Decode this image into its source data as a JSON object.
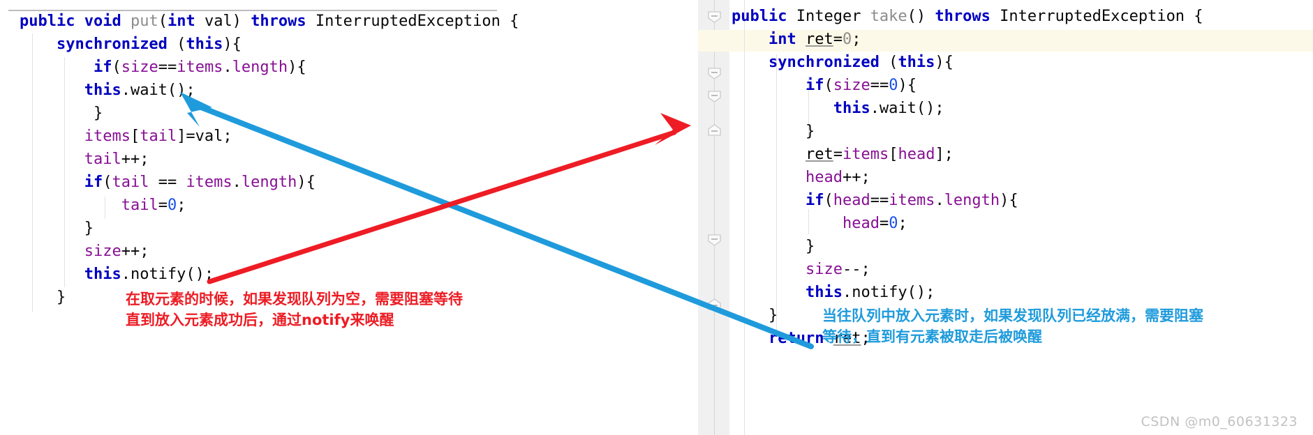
{
  "editor": {
    "left_pane": {
      "name": "put-method-editor",
      "lines": [
        [
          {
            "t": "public ",
            "c": "kw"
          },
          {
            "t": "void ",
            "c": "kw"
          },
          {
            "t": "put",
            "c": "meth"
          },
          {
            "t": "(",
            "c": "pln"
          },
          {
            "t": "int",
            "c": "kw"
          },
          {
            "t": " val) ",
            "c": "pln"
          },
          {
            "t": "throws",
            "c": "kw"
          },
          {
            "t": " InterruptedException {",
            "c": "pln"
          }
        ],
        [
          {
            "t": "    ",
            "c": "pln"
          },
          {
            "t": "synchronized",
            "c": "kw"
          },
          {
            "t": " (",
            "c": "pln"
          },
          {
            "t": "this",
            "c": "kw"
          },
          {
            "t": "){",
            "c": "pln"
          }
        ],
        [
          {
            "t": "        ",
            "c": "pln"
          },
          {
            "t": "if",
            "c": "kw"
          },
          {
            "t": "(",
            "c": "pln"
          },
          {
            "t": "size",
            "c": "fld"
          },
          {
            "t": "==",
            "c": "pln"
          },
          {
            "t": "items",
            "c": "fld"
          },
          {
            "t": ".",
            "c": "pln"
          },
          {
            "t": "length",
            "c": "fld"
          },
          {
            "t": "){",
            "c": "pln"
          }
        ],
        [
          {
            "t": "       ",
            "c": "pln"
          },
          {
            "t": "this",
            "c": "kw"
          },
          {
            "t": ".wait();",
            "c": "pln"
          }
        ],
        [
          {
            "t": "        }",
            "c": "pln"
          }
        ],
        [
          {
            "t": "       ",
            "c": "pln"
          },
          {
            "t": "items",
            "c": "fld"
          },
          {
            "t": "[",
            "c": "pln"
          },
          {
            "t": "tail",
            "c": "fld"
          },
          {
            "t": "]=val;",
            "c": "pln"
          }
        ],
        [
          {
            "t": "       ",
            "c": "pln"
          },
          {
            "t": "tail",
            "c": "fld"
          },
          {
            "t": "++;",
            "c": "pln"
          }
        ],
        [
          {
            "t": "       ",
            "c": "pln"
          },
          {
            "t": "if",
            "c": "kw"
          },
          {
            "t": "(",
            "c": "pln"
          },
          {
            "t": "tail",
            "c": "fld"
          },
          {
            "t": " == ",
            "c": "pln"
          },
          {
            "t": "items",
            "c": "fld"
          },
          {
            "t": ".",
            "c": "pln"
          },
          {
            "t": "length",
            "c": "fld"
          },
          {
            "t": "){",
            "c": "pln"
          }
        ],
        [
          {
            "t": "           ",
            "c": "pln"
          },
          {
            "t": "tail",
            "c": "fld"
          },
          {
            "t": "=",
            "c": "pln"
          },
          {
            "t": "0",
            "c": "num"
          },
          {
            "t": ";",
            "c": "pln"
          }
        ],
        [
          {
            "t": "       }",
            "c": "pln"
          }
        ],
        [
          {
            "t": "       ",
            "c": "pln"
          },
          {
            "t": "size",
            "c": "fld"
          },
          {
            "t": "++;",
            "c": "pln"
          }
        ],
        [
          {
            "t": "       ",
            "c": "pln"
          },
          {
            "t": "this",
            "c": "kw"
          },
          {
            "t": ".notify();",
            "c": "pln"
          }
        ],
        [
          {
            "t": "    }",
            "c": "pln"
          }
        ]
      ]
    },
    "right_pane": {
      "name": "take-method-editor",
      "lines": [
        [
          {
            "t": "public ",
            "c": "kw"
          },
          {
            "t": "Integer ",
            "c": "pln"
          },
          {
            "t": "take",
            "c": "meth"
          },
          {
            "t": "() ",
            "c": "pln"
          },
          {
            "t": "throws",
            "c": "kw"
          },
          {
            "t": " InterruptedException {",
            "c": "pln"
          }
        ],
        [
          {
            "t": "    ",
            "c": "pln"
          },
          {
            "t": "int",
            "c": "kw"
          },
          {
            "t": " ",
            "c": "pln"
          },
          {
            "t": "ret",
            "c": "under"
          },
          {
            "t": "=",
            "c": "pln"
          },
          {
            "t": "0",
            "c": "meth"
          },
          {
            "t": ";",
            "c": "pln"
          }
        ],
        [
          {
            "t": "    ",
            "c": "pln"
          },
          {
            "t": "synchronized",
            "c": "kw"
          },
          {
            "t": " (",
            "c": "pln"
          },
          {
            "t": "this",
            "c": "kw"
          },
          {
            "t": "){",
            "c": "pln"
          }
        ],
        [
          {
            "t": "        ",
            "c": "pln"
          },
          {
            "t": "if",
            "c": "kw"
          },
          {
            "t": "(",
            "c": "pln"
          },
          {
            "t": "size",
            "c": "fld"
          },
          {
            "t": "==",
            "c": "pln"
          },
          {
            "t": "0",
            "c": "num"
          },
          {
            "t": "){",
            "c": "pln"
          }
        ],
        [
          {
            "t": "           ",
            "c": "pln"
          },
          {
            "t": "this",
            "c": "kw"
          },
          {
            "t": ".wait();",
            "c": "pln"
          }
        ],
        [
          {
            "t": "        }",
            "c": "pln"
          }
        ],
        [
          {
            "t": "        ",
            "c": "pln"
          },
          {
            "t": "ret",
            "c": "under"
          },
          {
            "t": "=",
            "c": "pln"
          },
          {
            "t": "items",
            "c": "fld"
          },
          {
            "t": "[",
            "c": "pln"
          },
          {
            "t": "head",
            "c": "fld"
          },
          {
            "t": "];",
            "c": "pln"
          }
        ],
        [
          {
            "t": "        ",
            "c": "pln"
          },
          {
            "t": "head",
            "c": "fld"
          },
          {
            "t": "++;",
            "c": "pln"
          }
        ],
        [
          {
            "t": "        ",
            "c": "pln"
          },
          {
            "t": "if",
            "c": "kw"
          },
          {
            "t": "(",
            "c": "pln"
          },
          {
            "t": "head",
            "c": "fld"
          },
          {
            "t": "==",
            "c": "pln"
          },
          {
            "t": "items",
            "c": "fld"
          },
          {
            "t": ".",
            "c": "pln"
          },
          {
            "t": "length",
            "c": "fld"
          },
          {
            "t": "){",
            "c": "pln"
          }
        ],
        [
          {
            "t": "            ",
            "c": "pln"
          },
          {
            "t": "head",
            "c": "fld"
          },
          {
            "t": "=",
            "c": "pln"
          },
          {
            "t": "0",
            "c": "num"
          },
          {
            "t": ";",
            "c": "pln"
          }
        ],
        [
          {
            "t": "        }",
            "c": "pln"
          }
        ],
        [
          {
            "t": "        ",
            "c": "pln"
          },
          {
            "t": "size",
            "c": "fld"
          },
          {
            "t": "--;",
            "c": "pln"
          }
        ],
        [
          {
            "t": "        ",
            "c": "pln"
          },
          {
            "t": "this",
            "c": "kw"
          },
          {
            "t": ".notify();",
            "c": "pln"
          }
        ],
        [
          {
            "t": "    }",
            "c": "pln"
          }
        ],
        [
          {
            "t": "    ",
            "c": "pln"
          },
          {
            "t": "return",
            "c": "kw"
          },
          {
            "t": " ",
            "c": "pln"
          },
          {
            "t": "ret",
            "c": "under"
          },
          {
            "t": ";",
            "c": "pln"
          }
        ]
      ]
    }
  },
  "annotations": {
    "red": {
      "name": "red-annotation",
      "text": "在取元素的时候，如果发现队列为空，需要阻塞等待\n直到放入元素成功后，通过notify来唤醒",
      "color": "#ec1c24",
      "arrow_from": "this.notify() in put()",
      "arrow_to": "this.wait() in take()"
    },
    "blue": {
      "name": "blue-annotation",
      "text": "当往队列中放入元素时，如果发现队列已经放满，需要阻塞\n等待，直到有元素被取走后被唤醒",
      "color": "#1f9bdc",
      "arrow_from": "this.notify() in take()",
      "arrow_to": "this.wait() in put()"
    }
  },
  "watermark": {
    "text": "CSDN @m0_60631323"
  }
}
